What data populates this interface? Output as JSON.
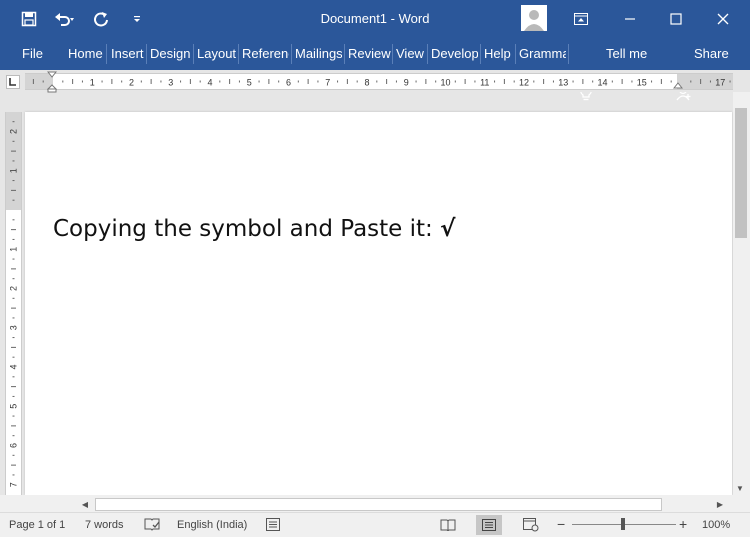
{
  "window": {
    "title": "Document1  -  Word",
    "controls": [
      "ribbon-display-icon",
      "minimize-icon",
      "maximize-icon",
      "close-icon"
    ]
  },
  "qat": {
    "items": [
      "save-icon",
      "undo-icon",
      "redo-icon",
      "customize-qat-icon"
    ]
  },
  "ribbon": {
    "tabs": [
      "File",
      "Home",
      "Insert",
      "Design",
      "Layout",
      "Referenc",
      "Mailings",
      "Review",
      "View",
      "Develop",
      "Help",
      "Gramma"
    ],
    "tell_me": "Tell me",
    "share": "Share"
  },
  "ruler": {
    "h_numbers": [
      "1",
      "2",
      "3",
      "4",
      "5",
      "6",
      "7",
      "8",
      "9",
      "10",
      "11",
      "12",
      "13",
      "14",
      "15",
      "17"
    ],
    "v_numbers": [
      "2",
      "1",
      "1",
      "2",
      "3",
      "4",
      "5",
      "6",
      "7"
    ]
  },
  "document": {
    "text": "Copying the symbol and Paste it: ",
    "symbol": "√"
  },
  "status": {
    "page": "Page 1 of 1",
    "words": "7 words",
    "language": "English (India)",
    "zoom": "100%"
  },
  "colors": {
    "ribbon": "#2b579a",
    "page": "#ffffff",
    "workspace": "#e6e6e6"
  }
}
